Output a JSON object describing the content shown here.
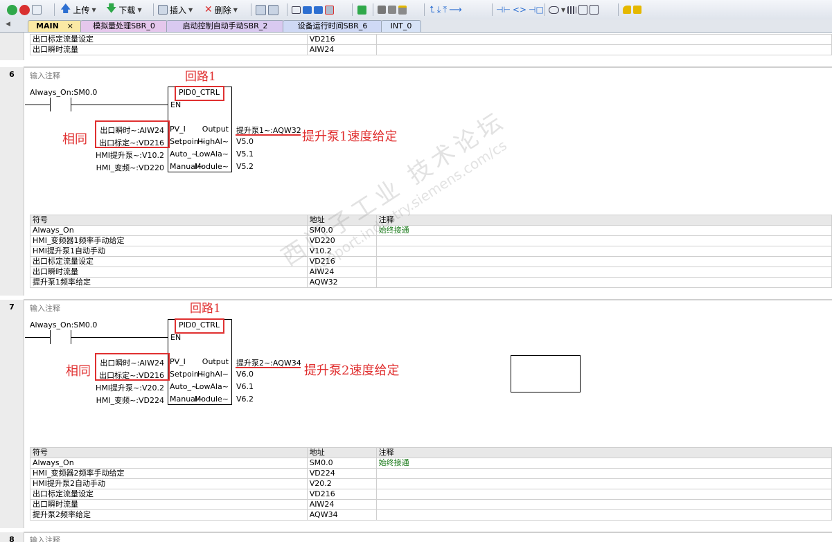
{
  "toolbar": {
    "upload_label": "上传",
    "download_label": "下载",
    "insert_label": "插入",
    "delete_label": "删除"
  },
  "tabs": [
    {
      "label": "MAIN",
      "close": "×"
    },
    {
      "label": "模拟量处理SBR_0"
    },
    {
      "label": "启动控制自动手动SBR_2"
    },
    {
      "label": "设备运行时间SBR_6"
    },
    {
      "label": "INT_0"
    }
  ],
  "top_table": {
    "rows": [
      {
        "symbol": "出口标定流量设定",
        "address": "VD216",
        "comment": ""
      },
      {
        "symbol": "出口瞬时流量",
        "address": "AIW24",
        "comment": ""
      }
    ]
  },
  "networks": [
    {
      "number": "6",
      "comment": "输入注释",
      "contact": "Always_On:SM0.0",
      "block": {
        "name": "PID0_CTRL",
        "en": "EN",
        "inputs": [
          {
            "pin": "PV_I",
            "wire": "出口瞬时~:AIW24"
          },
          {
            "pin": "Setpoin~",
            "wire": "出口标定~:VD216"
          },
          {
            "pin": "Auto_~",
            "wire": "HMI提升泵~:V10.2"
          },
          {
            "pin": "Manual~",
            "wire": "HMI_变频~:VD220"
          }
        ],
        "outputs": [
          {
            "pin": "Output",
            "wire": "提升泵1~:AQW32"
          },
          {
            "pin": "HighAl~",
            "wire": "V5.0"
          },
          {
            "pin": "LowAla~",
            "wire": "V5.1"
          },
          {
            "pin": "Module~",
            "wire": "V5.2"
          }
        ]
      },
      "annotations": {
        "loop": "回路1",
        "same": "相同",
        "speed": "提升泵1速度给定"
      },
      "table": {
        "headers": [
          "符号",
          "地址",
          "注释"
        ],
        "rows": [
          {
            "symbol": "Always_On",
            "address": "SM0.0",
            "comment": "始终接通"
          },
          {
            "symbol": "HMI_变频器1频率手动给定",
            "address": "VD220",
            "comment": ""
          },
          {
            "symbol": "HMI提升泵1自动手动",
            "address": "V10.2",
            "comment": ""
          },
          {
            "symbol": "出口标定流量设定",
            "address": "VD216",
            "comment": ""
          },
          {
            "symbol": "出口瞬时流量",
            "address": "AIW24",
            "comment": ""
          },
          {
            "symbol": "提升泵1频率给定",
            "address": "AQW32",
            "comment": ""
          }
        ]
      }
    },
    {
      "number": "7",
      "comment": "输入注释",
      "contact": "Always_On:SM0.0",
      "block": {
        "name": "PID0_CTRL",
        "en": "EN",
        "inputs": [
          {
            "pin": "PV_I",
            "wire": "出口瞬时~:AIW24"
          },
          {
            "pin": "Setpoin~",
            "wire": "出口标定~:VD216"
          },
          {
            "pin": "Auto_~",
            "wire": "HMI提升泵~:V20.2"
          },
          {
            "pin": "Manual~",
            "wire": "HMI_变频~:VD224"
          }
        ],
        "outputs": [
          {
            "pin": "Output",
            "wire": "提升泵2~:AQW34"
          },
          {
            "pin": "HighAl~",
            "wire": "V6.0"
          },
          {
            "pin": "LowAla~",
            "wire": "V6.1"
          },
          {
            "pin": "Module~",
            "wire": "V6.2"
          }
        ]
      },
      "annotations": {
        "loop": "回路1",
        "same": "相同",
        "speed": "提升泵2速度给定"
      },
      "table": {
        "headers": [
          "符号",
          "地址",
          "注释"
        ],
        "rows": [
          {
            "symbol": "Always_On",
            "address": "SM0.0",
            "comment": "始终接通"
          },
          {
            "symbol": "HMI_变频器2频率手动给定",
            "address": "VD224",
            "comment": ""
          },
          {
            "symbol": "HMI提升泵2自动手动",
            "address": "V20.2",
            "comment": ""
          },
          {
            "symbol": "出口标定流量设定",
            "address": "VD216",
            "comment": ""
          },
          {
            "symbol": "出口瞬时流量",
            "address": "AIW24",
            "comment": ""
          },
          {
            "symbol": "提升泵2频率给定",
            "address": "AQW34",
            "comment": ""
          }
        ]
      }
    },
    {
      "number": "8",
      "comment": "输入注释"
    }
  ],
  "watermark": {
    "line1": "西门子工业 技术论坛",
    "line2": "support.industry.siemens.com/cs"
  },
  "colors": {
    "accent_red": "#e03030",
    "tab_main": "#fbe9a4",
    "tab_sbr0": "#e5c7ec",
    "tab_sbr2": "#d9c9f0",
    "tab_sbr6": "#cfd9f5",
    "tab_int0": "#d7e3f7"
  }
}
